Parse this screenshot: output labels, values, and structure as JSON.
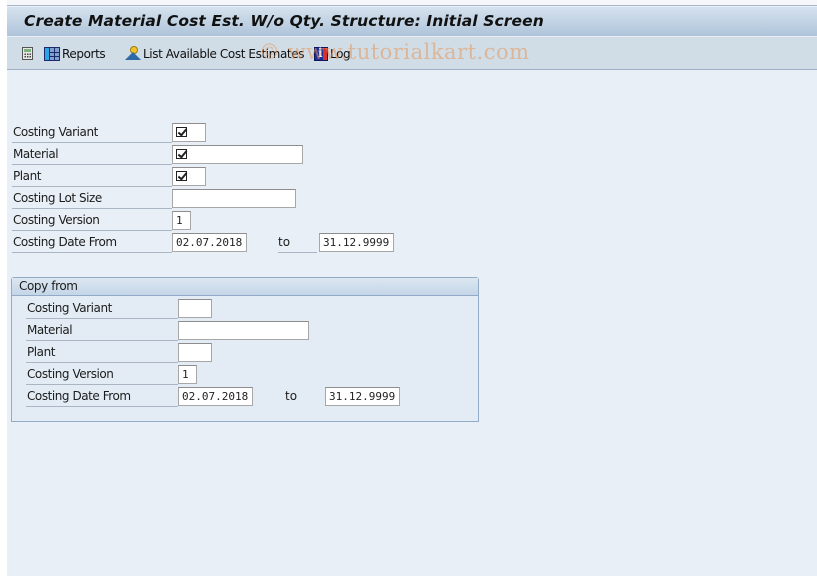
{
  "window": {
    "title": "Create Material Cost Est. W/o Qty. Structure: Initial Screen"
  },
  "toolbar": {
    "items": [
      {
        "icon": "calculator-icon",
        "label": ""
      },
      {
        "icon": "reports-grid-icon",
        "label": "Reports"
      },
      {
        "icon": "list-estimates-icon",
        "label": "List Available Cost Estimates"
      },
      {
        "icon": "log-info-icon",
        "label": "Log"
      }
    ]
  },
  "watermark": "© www.tutorialkart.com",
  "main_form": {
    "costing_variant": {
      "label": "Costing Variant",
      "value": "",
      "required": true
    },
    "material": {
      "label": "Material",
      "value": "",
      "required": true
    },
    "plant": {
      "label": "Plant",
      "value": "",
      "required": true
    },
    "costing_lot_size": {
      "label": "Costing Lot Size",
      "value": ""
    },
    "costing_version": {
      "label": "Costing Version",
      "value": "1"
    },
    "costing_date": {
      "label": "Costing Date From",
      "from": "02.07.2018",
      "to_label": "to",
      "to": "31.12.9999"
    }
  },
  "copy_from": {
    "title": "Copy from",
    "costing_variant": {
      "label": "Costing Variant",
      "value": ""
    },
    "material": {
      "label": "Material",
      "value": ""
    },
    "plant": {
      "label": "Plant",
      "value": ""
    },
    "costing_version": {
      "label": "Costing Version",
      "value": "1"
    },
    "costing_date": {
      "label": "Costing Date From",
      "from": "02.07.2018",
      "to_label": "to",
      "to": "31.12.9999"
    }
  }
}
